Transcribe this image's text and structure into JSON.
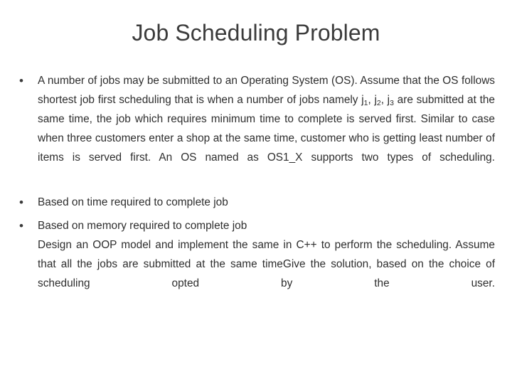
{
  "slide": {
    "title": "Job Scheduling Problem",
    "background_color": "#ffffff",
    "title_color": "#3b3b3b",
    "body_color": "#2e2e2e",
    "bullet_glyph": "•"
  },
  "content": {
    "bullet_1": {
      "marker": "•",
      "text_part_1": "A number of jobs may be submitted to an Operating System (OS). Assume that the OS follows shortest job first scheduling that is when a number of jobs namely j",
      "job_1_sub": "1",
      "sep_1": ", j",
      "job_2_sub": "2",
      "sep_2": ", j",
      "job_3_sub": "3",
      "text_part_2": " are submitted at the same time, the job which requires minimum time to complete is served first. Similar to case when three customers enter a shop at the same time, customer who is getting least number of items is served first. An OS named as OS1_X supports two types of scheduling."
    },
    "bullet_2": {
      "marker": "•",
      "text": "Based on time required to complete job"
    },
    "bullet_3": {
      "marker": "•",
      "text": "Based on memory required to complete job"
    },
    "closing_paragraph": {
      "line_1": "Design an OOP model and implement the same in C++ to perform the scheduling. Assume that all the jobs are submitted at the same time",
      "line_2": "Give the solution, based on the choice of scheduling opted by the user."
    }
  }
}
